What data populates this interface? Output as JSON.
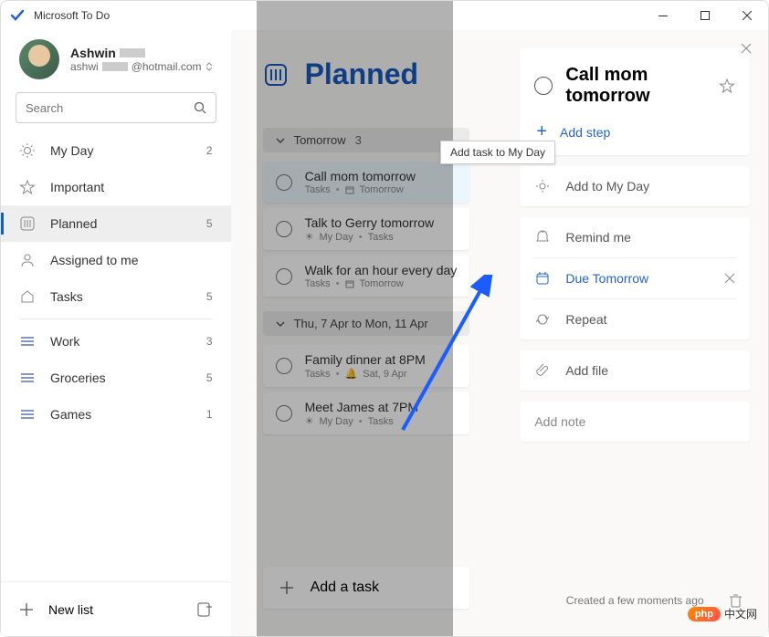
{
  "titlebar": {
    "title": "Microsoft To Do"
  },
  "profile": {
    "name": "Ashwin",
    "email_suffix": "@hotmail.com"
  },
  "search": {
    "placeholder": "Search"
  },
  "nav": {
    "items": [
      {
        "icon": "sun",
        "label": "My Day",
        "count": "2"
      },
      {
        "icon": "star",
        "label": "Important",
        "count": ""
      },
      {
        "icon": "planned",
        "label": "Planned",
        "count": "5",
        "active": true
      },
      {
        "icon": "user",
        "label": "Assigned to me",
        "count": ""
      },
      {
        "icon": "home",
        "label": "Tasks",
        "count": "5"
      }
    ],
    "custom": [
      {
        "label": "Work",
        "count": "3"
      },
      {
        "label": "Groceries",
        "count": "5"
      },
      {
        "label": "Games",
        "count": "1"
      }
    ]
  },
  "sidebar_footer": {
    "newlist": "New list"
  },
  "main": {
    "title": "Planned",
    "groups": [
      {
        "header": "Tomorrow",
        "count": "3",
        "tasks": [
          {
            "title": "Call mom tomorrow",
            "meta": [
              "Tasks",
              "•",
              "📅",
              "Tomorrow"
            ],
            "selected": true
          },
          {
            "title": "Talk to Gerry tomorrow",
            "meta": [
              "☀",
              "My Day",
              "•",
              "Tasks"
            ]
          },
          {
            "title": "Walk for an hour every day",
            "meta": [
              "Tasks",
              "•",
              "📅",
              "Tomorrow"
            ]
          }
        ]
      },
      {
        "header": "Thu, 7 Apr to Mon, 11 Apr",
        "tasks": [
          {
            "title": "Family dinner at 8PM",
            "meta": [
              "Tasks",
              "•",
              "🔔",
              "Sat, 9 Apr"
            ]
          },
          {
            "title": "Meet James at 7PM",
            "meta": [
              "☀",
              "My Day",
              "•",
              "Tasks"
            ]
          }
        ]
      }
    ],
    "addtask": "Add a task"
  },
  "detail": {
    "title": "Call mom tomorrow",
    "add_step": "Add step",
    "add_myday": "Add to My Day",
    "remind": "Remind me",
    "due": "Due Tomorrow",
    "repeat": "Repeat",
    "addfile": "Add file",
    "addnote": "Add note",
    "footer": "Created a few moments ago"
  },
  "tooltip": "Add task to My Day",
  "watermark": {
    "badge": "php",
    "text": "中文网"
  }
}
